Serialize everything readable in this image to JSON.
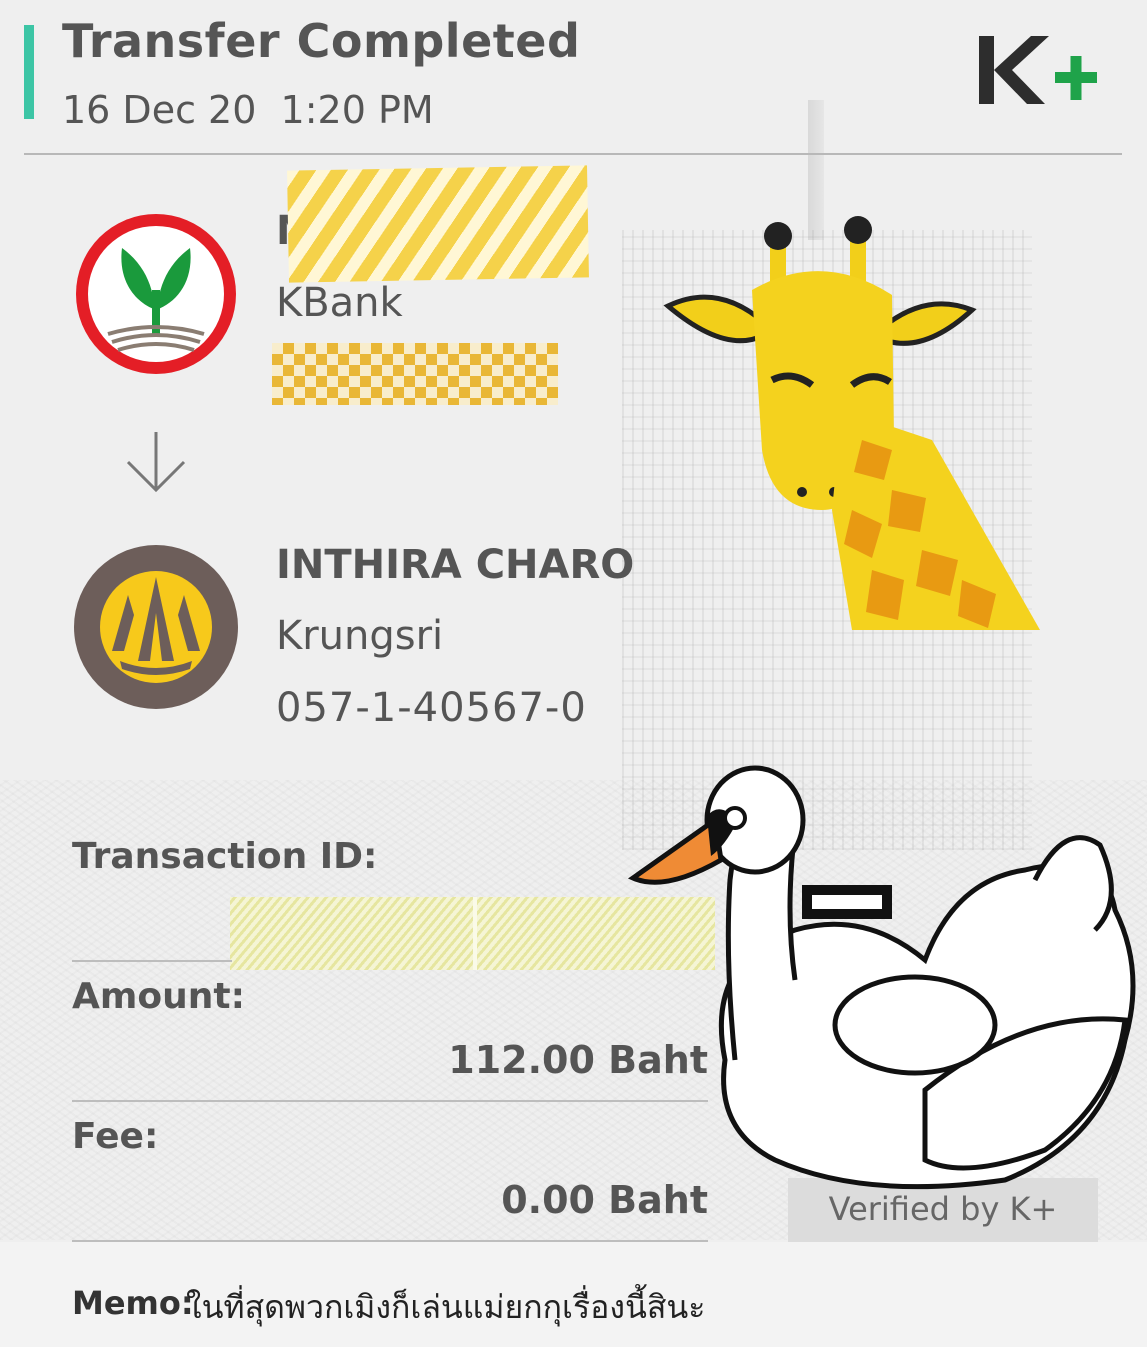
{
  "header": {
    "title": "Transfer Completed",
    "datetime": "16 Dec 20  1:20 PM",
    "accent_color": "#3cc5a5",
    "brand_logo": "K+"
  },
  "sender": {
    "name": "M",
    "bank": "KBank",
    "logo_icon": "kbank-logo-icon",
    "brand_color": "#1a9a3c"
  },
  "transfer_icon": "arrow-down-icon",
  "receiver": {
    "name": "INTHIRA CHARO",
    "bank": "Krungsri",
    "account": "057-1-40567-0",
    "logo_icon": "krungsri-logo-icon",
    "brand_color": "#6d5e5a"
  },
  "details": {
    "transaction_id_label": "Transaction ID:",
    "amount_label": "Amount:",
    "amount_value": "112.00 Baht",
    "fee_label": "Fee:",
    "fee_value": "0.00 Baht"
  },
  "verified": {
    "text": "Verified by K+"
  },
  "memo": {
    "label": "Memo:",
    "text": "ในที่สุดพวกเมิงก็เล่นแม่ยกกุเรื่องนี้สินะ"
  },
  "stickers": [
    "giraffe-sticker",
    "swan-float-sticker"
  ]
}
